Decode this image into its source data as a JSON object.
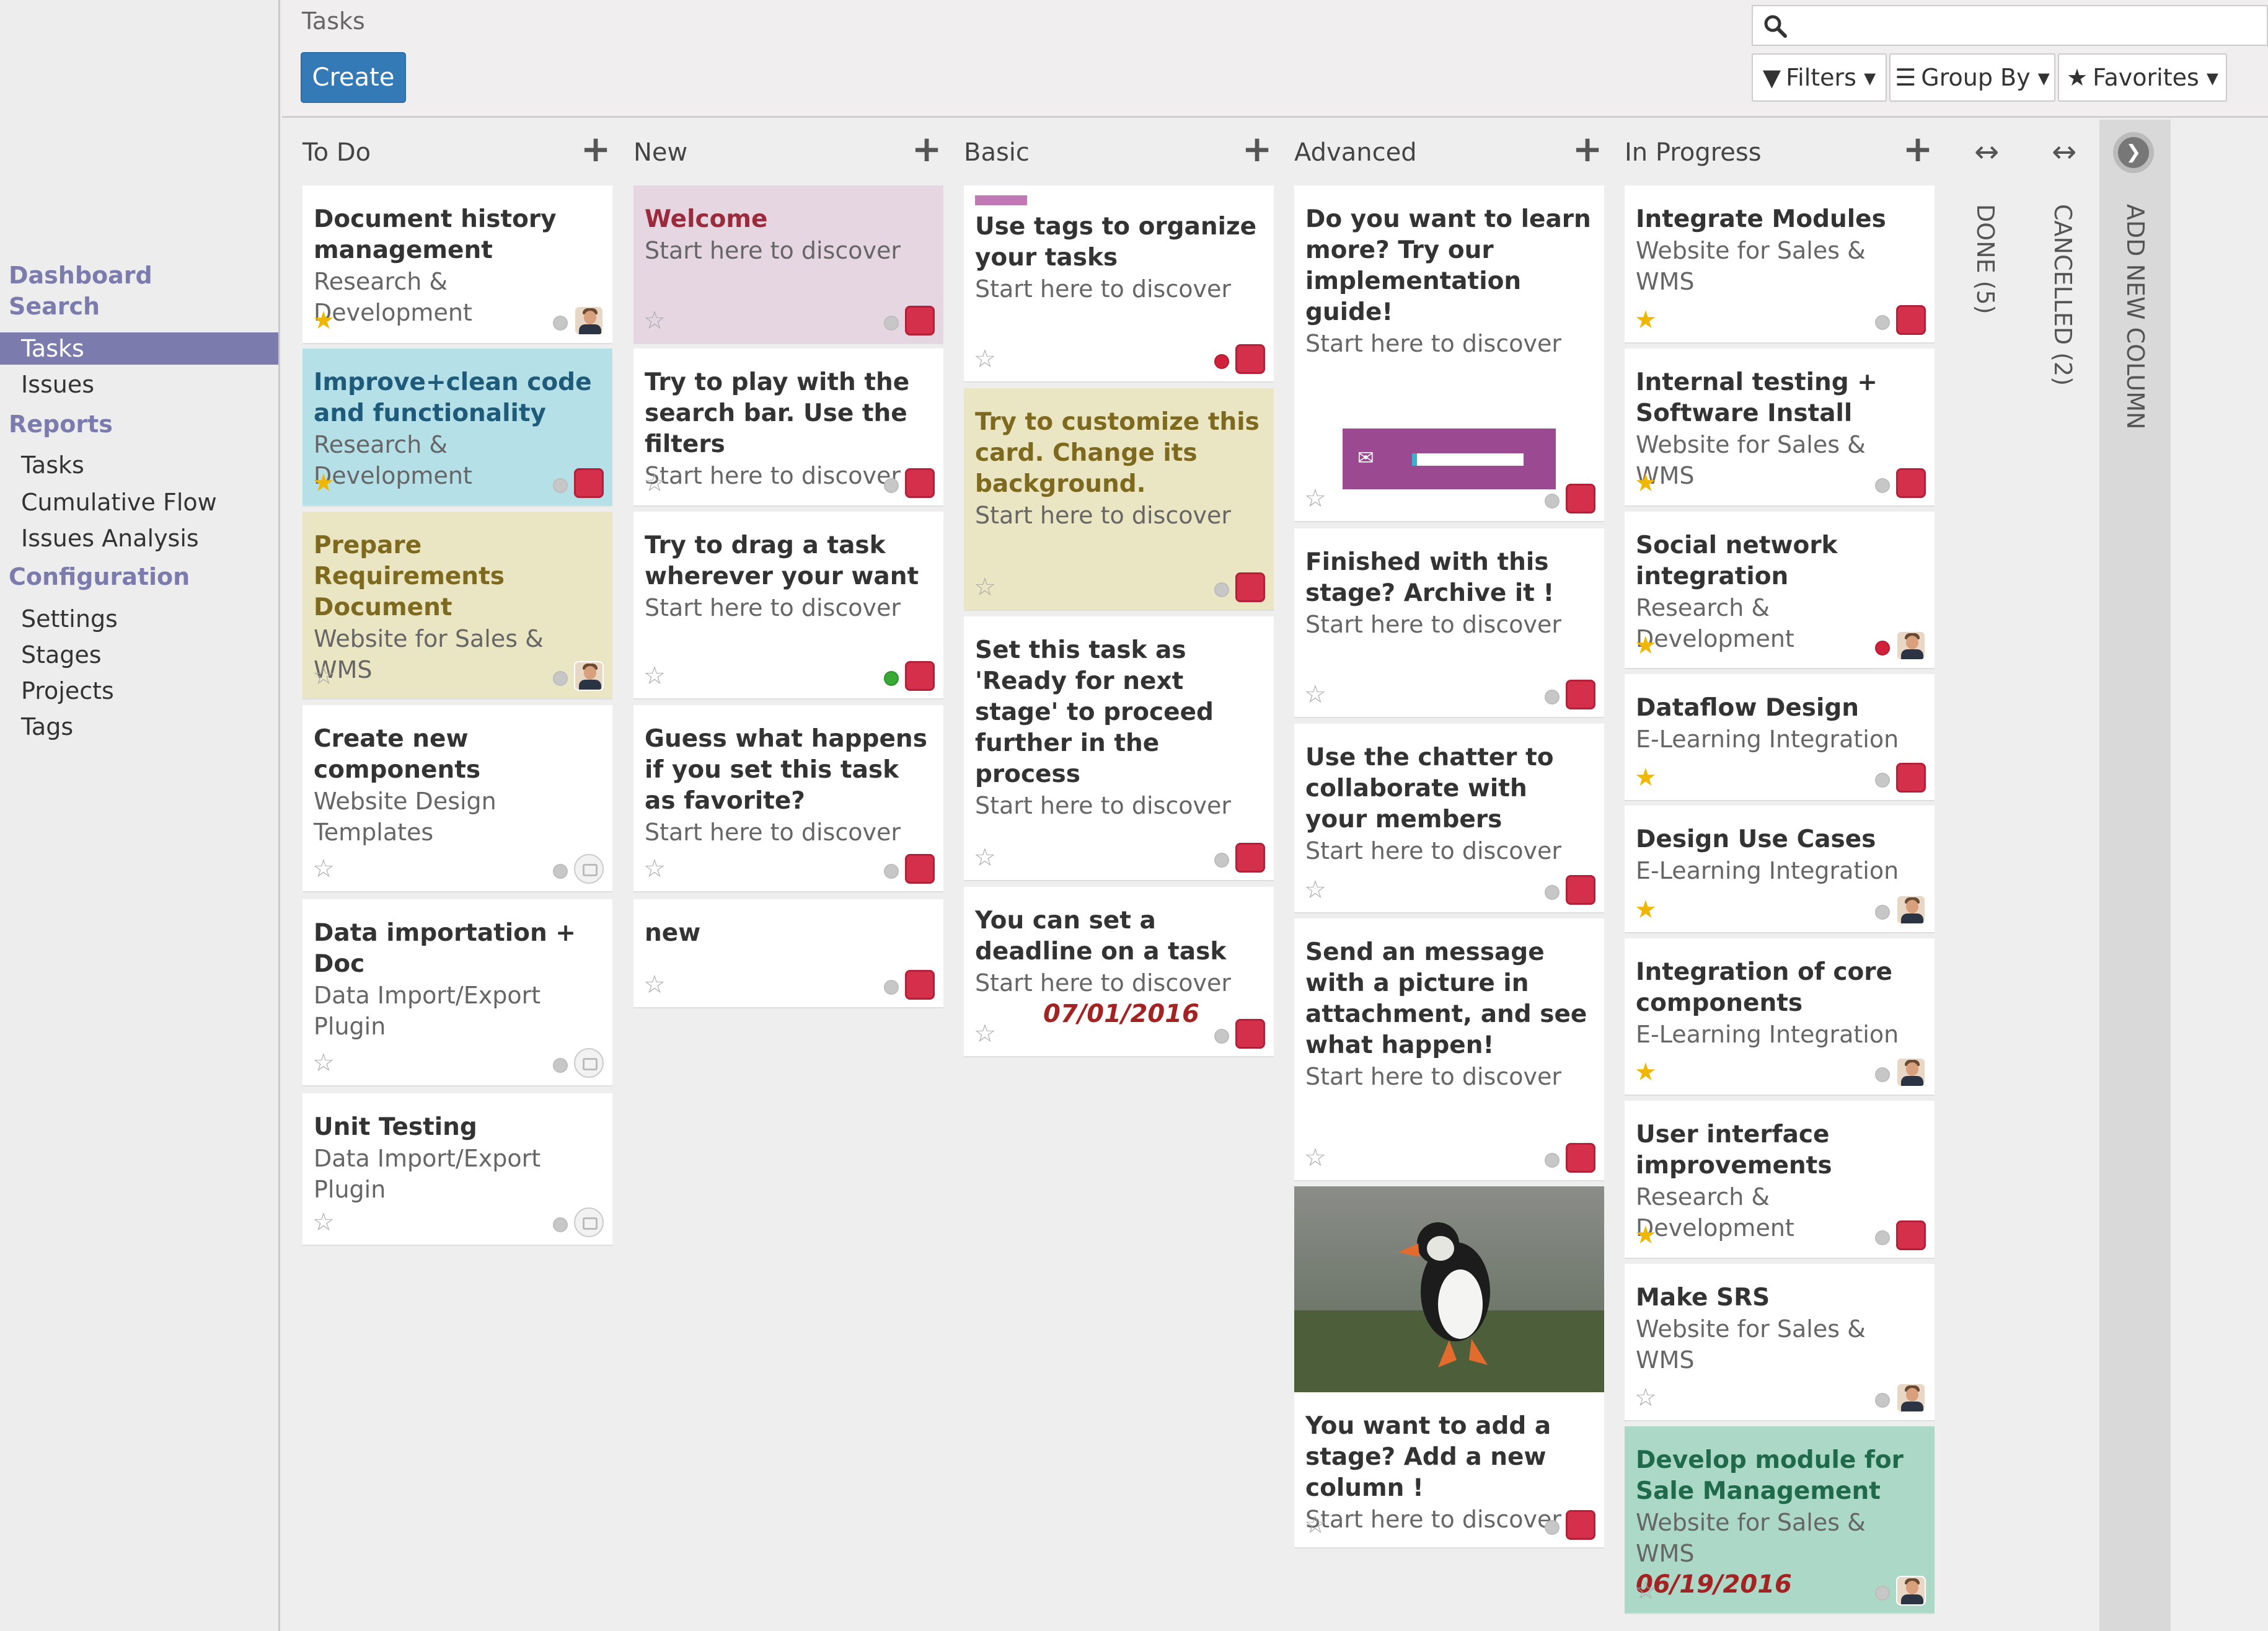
{
  "sidebar": {
    "sections": [
      {
        "label": "Dashboard"
      },
      {
        "label": "Search"
      },
      {
        "label": "Reports"
      },
      {
        "label": "Configuration"
      }
    ],
    "items": {
      "tasks": "Tasks",
      "issues": "Issues",
      "report_tasks": "Tasks",
      "cumulative_flow": "Cumulative Flow",
      "issues_analysis": "Issues Analysis",
      "settings": "Settings",
      "stages": "Stages",
      "projects": "Projects",
      "tags": "Tags"
    }
  },
  "control": {
    "breadcrumb": "Tasks",
    "create_label": "Create",
    "search_placeholder": "",
    "filters_label": "Filters",
    "groupby_label": "Group By",
    "favorites_label": "Favorites"
  },
  "columns": [
    {
      "title": "To Do",
      "cards": [
        {
          "title": "Document history management",
          "sub": "Research & Development",
          "starred": true,
          "dot": "grey",
          "avatar": "person",
          "bg": "#ffffff",
          "title_color": "#333333"
        },
        {
          "title": "Improve+clean code and functionality",
          "sub": "Research & Development",
          "starred": true,
          "dot": "grey",
          "avatar": "red",
          "bg": "#b6e0e8",
          "title_color": "#1e5a7a"
        },
        {
          "title": "Prepare Requirements Document",
          "sub": "Website for Sales & WMS",
          "starred": false,
          "dot": "grey",
          "avatar": "person",
          "bg": "#eae5c2",
          "title_color": "#7d6a1e"
        },
        {
          "title": "Create new components",
          "sub": "Website Design Templates",
          "starred": false,
          "dot": "grey",
          "avatar": "grey",
          "bg": "#ffffff",
          "title_color": "#333333"
        },
        {
          "title": "Data importation + Doc",
          "sub": "Data Import/Export Plugin",
          "starred": false,
          "dot": "grey",
          "avatar": "grey",
          "bg": "#ffffff",
          "title_color": "#333333"
        },
        {
          "title": "Unit Testing",
          "sub": "Data Import/Export Plugin",
          "starred": false,
          "dot": "grey",
          "avatar": "grey",
          "bg": "#ffffff",
          "title_color": "#333333"
        }
      ]
    },
    {
      "title": "New",
      "cards": [
        {
          "title": "Welcome",
          "sub": "Start here to discover",
          "starred": false,
          "dot": "grey",
          "avatar": "red",
          "bg": "#e5d6e1",
          "title_color": "#9b2a3c"
        },
        {
          "title": "Try to play with the search bar. Use the filters",
          "sub": "Start here to discover",
          "starred": false,
          "dot": "grey",
          "avatar": "red",
          "bg": "#ffffff",
          "title_color": "#333333"
        },
        {
          "title": "Try to drag a task wherever your want",
          "sub": "Start here to discover",
          "starred": false,
          "dot": "green",
          "avatar": "red",
          "bg": "#ffffff",
          "title_color": "#333333"
        },
        {
          "title": "Guess what happens if you set this task as favorite?",
          "sub": "Start here to discover",
          "starred": false,
          "dot": "grey",
          "avatar": "red",
          "bg": "#ffffff",
          "title_color": "#333333"
        },
        {
          "title": "new",
          "sub": "",
          "starred": false,
          "dot": "grey",
          "avatar": "red",
          "bg": "#ffffff",
          "title_color": "#333333"
        }
      ]
    },
    {
      "title": "Basic",
      "cards": [
        {
          "title": "Use tags to organize your tasks",
          "sub": "Start here to discover",
          "starred": false,
          "dot": "red",
          "avatar": "red",
          "bg": "#ffffff",
          "title_color": "#333333"
        },
        {
          "title": "Try to customize this card. Change its background.",
          "sub": "Start here to discover",
          "starred": false,
          "dot": "grey",
          "avatar": "red",
          "bg": "#eae5c2",
          "title_color": "#7d6a1e"
        },
        {
          "title": "Set this task as 'Ready for next stage' to proceed further in the process",
          "sub": "Start here to discover",
          "starred": false,
          "dot": "grey",
          "avatar": "red",
          "bg": "#ffffff",
          "title_color": "#333333"
        },
        {
          "title": "You can set a deadline on a task",
          "sub": "Start here to discover",
          "date": "07/01/2016",
          "starred": false,
          "dot": "grey",
          "avatar": "red",
          "bg": "#ffffff",
          "title_color": "#333333"
        }
      ]
    },
    {
      "title": "Advanced",
      "cards": [
        {
          "title": "Do you want to learn more? Try our implementation guide!",
          "sub": "Start here to discover",
          "starred": false,
          "dot": "grey",
          "avatar": "red",
          "bg": "#ffffff",
          "title_color": "#333333"
        },
        {
          "title": "Finished with this stage? Archive it !",
          "sub": "Start here to discover",
          "starred": false,
          "dot": "grey",
          "avatar": "red",
          "bg": "#ffffff",
          "title_color": "#333333"
        },
        {
          "title": "Use the chatter to collaborate with your members",
          "sub": "Start here to discover",
          "starred": false,
          "dot": "grey",
          "avatar": "red",
          "bg": "#ffffff",
          "title_color": "#333333"
        },
        {
          "title": "Send an message with a picture in attachment, and see what happen!",
          "sub": "Start here to discover",
          "starred": false,
          "dot": "grey",
          "avatar": "red",
          "bg": "#ffffff",
          "title_color": "#333333"
        },
        {
          "title": "You want to add a stage? Add a new column !",
          "sub": "Start here to discover",
          "starred": false,
          "dot": "grey",
          "avatar": "red",
          "bg": "#ffffff",
          "title_color": "#333333"
        }
      ]
    },
    {
      "title": "In Progress",
      "cards": [
        {
          "title": "Integrate Modules",
          "sub": "Website for Sales & WMS",
          "starred": true,
          "dot": "grey",
          "avatar": "red",
          "bg": "#ffffff",
          "title_color": "#333333"
        },
        {
          "title": "Internal testing + Software Install",
          "sub": "Website for Sales & WMS",
          "starred": true,
          "dot": "grey",
          "avatar": "red",
          "bg": "#ffffff",
          "title_color": "#333333"
        },
        {
          "title": "Social network integration",
          "sub": "Research & Development",
          "starred": true,
          "dot": "red",
          "avatar": "person",
          "bg": "#ffffff",
          "title_color": "#333333"
        },
        {
          "title": "Dataflow Design",
          "sub": "E-Learning Integration",
          "starred": true,
          "dot": "grey",
          "avatar": "red",
          "bg": "#ffffff",
          "title_color": "#333333"
        },
        {
          "title": "Design Use Cases",
          "sub": "E-Learning Integration",
          "starred": true,
          "dot": "grey",
          "avatar": "person",
          "bg": "#ffffff",
          "title_color": "#333333"
        },
        {
          "title": "Integration of core components",
          "sub": "E-Learning Integration",
          "starred": true,
          "dot": "grey",
          "avatar": "person",
          "bg": "#ffffff",
          "title_color": "#333333"
        },
        {
          "title": "User interface improvements",
          "sub": "Research & Development",
          "starred": true,
          "dot": "grey",
          "avatar": "red",
          "bg": "#ffffff",
          "title_color": "#333333"
        },
        {
          "title": "Make SRS",
          "sub": "Website for Sales & WMS",
          "starred": false,
          "dot": "grey",
          "avatar": "person",
          "bg": "#ffffff",
          "title_color": "#333333"
        },
        {
          "title": "Develop module for Sale Management",
          "sub": "Website for Sales & WMS",
          "date": "06/19/2016",
          "starred": false,
          "dot": "grey",
          "avatar": "person",
          "bg": "#acd8c8",
          "title_color": "#1e6a4a"
        }
      ]
    }
  ],
  "folded": [
    {
      "label": "DONE (5)"
    },
    {
      "label": "CANCELLED (2)"
    }
  ],
  "add_column_label": "ADD NEW COLUMN",
  "colors": {
    "accent": "#7c7bad",
    "primary": "#337ab7",
    "star": "#f0b700",
    "deadline": "#a52222"
  }
}
